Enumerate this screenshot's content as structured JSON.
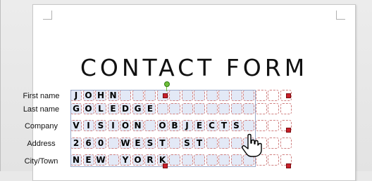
{
  "form": {
    "title": "CONTACT FORM",
    "fields": [
      {
        "label": "First name",
        "value": "JOHN"
      },
      {
        "label": "Last name",
        "value": "GOLEDGE"
      },
      {
        "label": "Company",
        "value": "VISION OBJECTS"
      },
      {
        "label": "Address",
        "value": "260 WEST ST"
      },
      {
        "label": "City/Town",
        "value": "NEW YORK"
      }
    ]
  },
  "colors": {
    "cell_border": "#d08080",
    "selection_fill": "#e3e9f6",
    "handle": "#c8202a",
    "rotate_handle": "#6fbf3a"
  },
  "icons": {
    "cursor": "hand-pointer-icon",
    "rotate": "rotate-handle-icon"
  }
}
